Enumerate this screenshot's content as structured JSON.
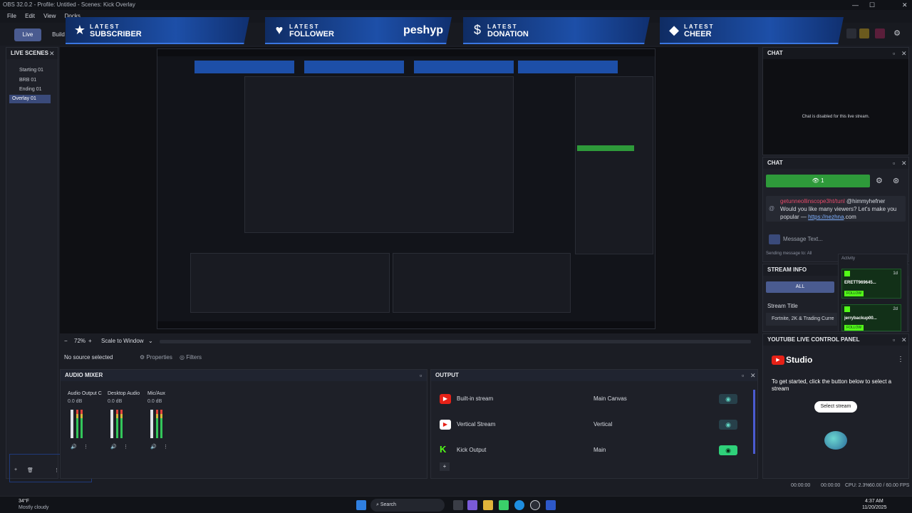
{
  "window": {
    "title": "OBS 32.0.2 - Profile: Untitled - Scenes: Kick Overlay"
  },
  "menu": [
    "File",
    "Edit",
    "View",
    "Docks"
  ],
  "toolbar": {
    "live": "Live",
    "build": "Build"
  },
  "banners": [
    {
      "latest": "LATEST",
      "label": "SUBSCRIBER",
      "icon": "star-icon",
      "name": ""
    },
    {
      "latest": "LATEST",
      "label": "FOLLOWER",
      "icon": "heart-icon",
      "name": "peshyp"
    },
    {
      "latest": "LATEST",
      "label": "DONATION",
      "icon": "dollar-icon",
      "name": ""
    },
    {
      "latest": "LATEST",
      "label": "CHEER",
      "icon": "diamond-icon",
      "name": ""
    }
  ],
  "scenes": {
    "title": "LIVE SCENES",
    "items": [
      "Starting 01",
      "BRB 01",
      "Ending 01",
      "Overlay 01"
    ],
    "selected": 3
  },
  "preview": {
    "zoom": "72%",
    "scale": "Scale to Window"
  },
  "sources": {
    "no_source": "No source selected",
    "properties": "Properties",
    "filters": "Filters"
  },
  "mixer": {
    "title": "AUDIO MIXER",
    "channels": [
      {
        "name": "Audio Output C",
        "db": "0.0 dB"
      },
      {
        "name": "Desktop Audio",
        "db": "0.0 dB"
      },
      {
        "name": "Mic/Aux",
        "db": "0.0 dB"
      }
    ]
  },
  "output": {
    "title": "OUTPUT",
    "rows": [
      {
        "name": "Built-in stream",
        "target": "Main Canvas",
        "active": false
      },
      {
        "name": "Vertical Stream",
        "target": "Vertical",
        "active": false
      },
      {
        "name": "Kick Output",
        "target": "Main",
        "active": true
      }
    ]
  },
  "chat_top": {
    "title": "CHAT",
    "disabled": "Chat is disabled for this live stream."
  },
  "chat": {
    "title": "CHAT",
    "viewers": "1",
    "msg_user": "getunneollinscope3ht/tunl",
    "msg_mention": "@himmyhefner",
    "msg_text": "Would you like many viewers? Let's make you popular —",
    "msg_link": "https://nezhna",
    "msg_link_suffix": ".com",
    "placeholder": "Message Text...",
    "sending": "Sending message to: All"
  },
  "activity": {
    "title": "Activity",
    "items": [
      {
        "name": "ERETT969645...",
        "age": "1d",
        "action": "FOLLOW"
      },
      {
        "name": "jerrybackup00...",
        "age": "2d",
        "action": "FOLLOW"
      }
    ]
  },
  "stream_info": {
    "title": "STREAM INFO",
    "all": "ALL",
    "stream_title_label": "Stream Title",
    "stream_title_value": "Fortnite, 2K & Trading Curre"
  },
  "youtube": {
    "title": "YOUTUBE LIVE CONTROL PANEL",
    "brand": "Studio",
    "prompt": "To get started, click the button below to select a stream",
    "button": "Select stream"
  },
  "status": {
    "time1": "00:00:00",
    "time2": "00:00:00",
    "cpu": "CPU: 2.3%",
    "fps": "60.00 / 60.00 FPS"
  },
  "taskbar": {
    "weather_temp": "34°F",
    "weather_desc": "Mostly cloudy",
    "search": "Search",
    "clock": "4:37 AM",
    "date": "11/20/2025"
  }
}
